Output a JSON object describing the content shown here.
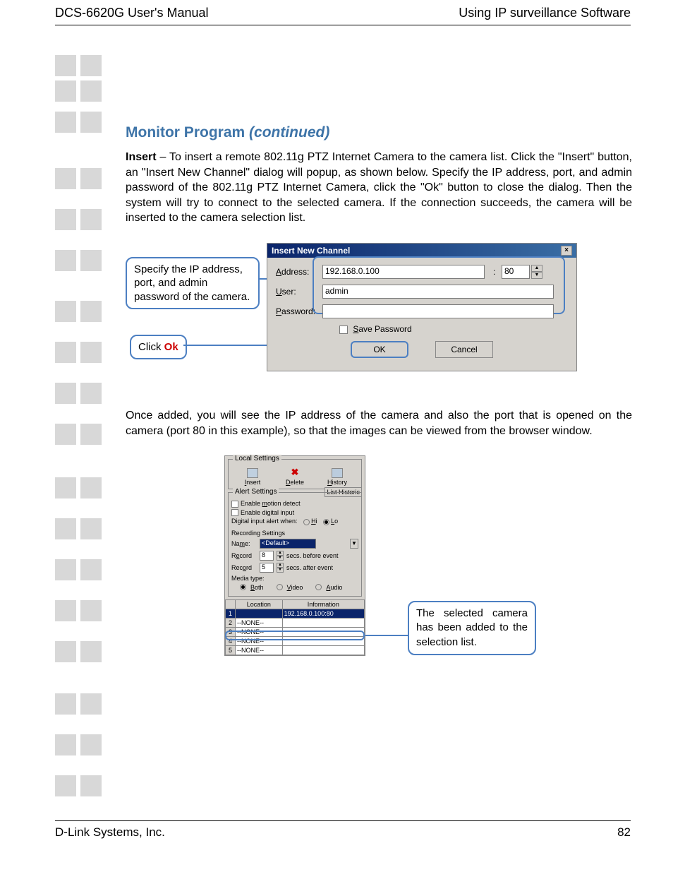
{
  "header": {
    "left": "DCS-6620G User's Manual",
    "right": "Using IP surveillance Software"
  },
  "heading": {
    "main": "Monitor Program ",
    "continued": "(continued)"
  },
  "para1": {
    "lead": "Insert",
    "body": " – To insert a remote 802.11g PTZ Internet Camera  to the camera list. Click the \"Insert\" button, an \"Insert New Channel\" dialog will popup, as shown below. Specify the IP address, port, and admin password of the 802.11g PTZ Internet Camera, click the \"Ok\" button to close the dialog. Then the system will try to connect to the selected camera. If the connection succeeds, the camera will be inserted to the camera selection list."
  },
  "callout_spec": "Specify the IP address, port, and admin password of the camera.",
  "callout_ok_prefix": "Click ",
  "callout_ok_word": "Ok",
  "dialog": {
    "title": "Insert New Channel",
    "address_label": "Address:",
    "address_value": "192.168.0.100",
    "port_value": "80",
    "user_label": "User:",
    "user_value": "admin",
    "password_label": "Password:",
    "save_password": "Save Password",
    "ok": "OK",
    "cancel": "Cancel"
  },
  "para2": "Once added, you will see the IP address of the camera and also the port that is opened on the camera (port 80 in this example), so that the images can be viewed from the browser window.",
  "panel": {
    "local_settings_title": "Local Settings",
    "insert": "Insert",
    "delete": "Delete",
    "history": "History",
    "list_historic": "List Historic",
    "alert_settings_title": "Alert Settings",
    "enable_motion": "Enable motion detect",
    "enable_digital": "Enable digital input",
    "digital_when": "Digital input alert when:",
    "hi": "Hi",
    "lo": "Lo",
    "recording_settings": "Recording Settings",
    "name_label": "Name:",
    "name_value": "<Default>",
    "record_label": "Record",
    "record_before_val": "8",
    "record_before_txt": "secs. before event",
    "record_after_val": "5",
    "record_after_txt": "secs. after event",
    "media_type": "Media type:",
    "both": "Both",
    "video": "Video",
    "audio": "Audio",
    "col_location": "Location",
    "col_information": "Information",
    "rows": [
      {
        "n": "1",
        "loc": "",
        "info": "192.168.0.100:80"
      },
      {
        "n": "2",
        "loc": "--NONE--",
        "info": ""
      },
      {
        "n": "3",
        "loc": "--NONE--",
        "info": ""
      },
      {
        "n": "4",
        "loc": "--NONE--",
        "info": ""
      },
      {
        "n": "5",
        "loc": "--NONE--",
        "info": ""
      }
    ]
  },
  "callout_added": "The selected camera has been added to the selection list.",
  "footer": {
    "company": "D-Link Systems, Inc.",
    "page": "82"
  }
}
